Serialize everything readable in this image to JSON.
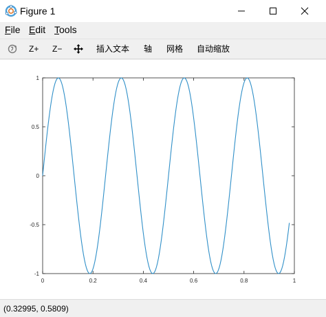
{
  "window": {
    "title": "Figure 1",
    "controls": {
      "minimize_icon": "minimize-icon",
      "maximize_icon": "maximize-icon",
      "close_icon": "close-icon"
    }
  },
  "menu": {
    "items": [
      {
        "label": "File",
        "mnemonic": "F"
      },
      {
        "label": "Edit",
        "mnemonic": "E"
      },
      {
        "label": "Tools",
        "mnemonic": "T"
      }
    ]
  },
  "toolbar": {
    "rotate_icon": "rotate-3d-icon",
    "zoom_in_label": "Z+",
    "zoom_out_label": "Z−",
    "pan_icon": "pan-move-icon",
    "insert_text_label": "插入文本",
    "axis_label": "轴",
    "grid_label": "网格",
    "autoscale_label": "自动缩放"
  },
  "status": {
    "coordinates": "(0.32995, 0.5809)"
  },
  "colors": {
    "line": "#2f8fc8",
    "axes": "#262626",
    "background": "#ffffff",
    "chrome": "#f0f0f0"
  },
  "chart_data": {
    "type": "line",
    "function": "sin(2*pi*4*x)",
    "series": [
      {
        "x": [
          0,
          0.0625,
          0.125,
          0.1875,
          0.25,
          0.3125,
          0.375,
          0.4375,
          0.5,
          0.5625,
          0.625,
          0.6875,
          0.75,
          0.8125,
          0.875,
          0.9375,
          0.98
        ],
        "values": [
          0,
          1,
          0,
          -1,
          0,
          1,
          0,
          -1,
          0,
          1,
          0,
          -1,
          0,
          1,
          0,
          -1,
          -0.48
        ]
      }
    ],
    "xlim": [
      0,
      1
    ],
    "ylim": [
      -1,
      1
    ],
    "xticks": [
      "0",
      "0.2",
      "0.4",
      "0.6",
      "0.8",
      "1"
    ],
    "yticks": [
      "1",
      "0.5",
      "0",
      "-0.5",
      "-1"
    ],
    "title": "",
    "xlabel": "",
    "ylabel": "",
    "grid": false
  }
}
